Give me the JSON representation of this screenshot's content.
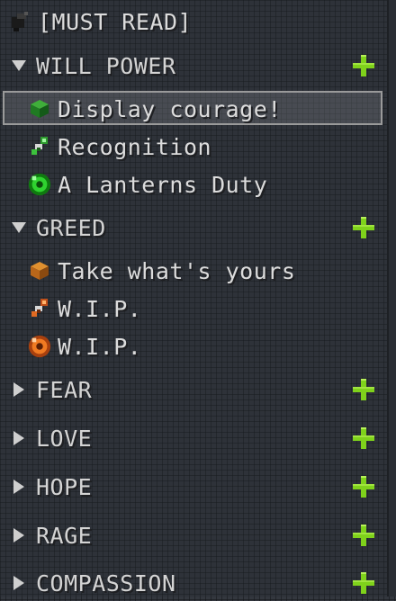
{
  "top_item": {
    "label": "[MUST READ]",
    "icon": "black-book-icon"
  },
  "categories": [
    {
      "label": "WILL POWER",
      "expanded": true,
      "add_icon": "plus-icon"
    },
    {
      "label": "GREED",
      "expanded": true,
      "add_icon": "plus-icon"
    },
    {
      "label": "FEAR",
      "expanded": false,
      "add_icon": "plus-icon"
    },
    {
      "label": "LOVE",
      "expanded": false,
      "add_icon": "plus-icon"
    },
    {
      "label": "HOPE",
      "expanded": false,
      "add_icon": "plus-icon"
    },
    {
      "label": "RAGE",
      "expanded": false,
      "add_icon": "plus-icon"
    },
    {
      "label": "COMPASSION",
      "expanded": false,
      "add_icon": "plus-icon"
    }
  ],
  "will_power_quests": [
    {
      "label": "Display courage!",
      "icon": "green-cube-icon",
      "selected": true
    },
    {
      "label": "Recognition",
      "icon": "green-ring-icon",
      "selected": false
    },
    {
      "label": "A Lanterns Duty",
      "icon": "green-lantern-icon",
      "selected": false
    }
  ],
  "greed_quests": [
    {
      "label": "Take what's yours",
      "icon": "orange-cube-icon",
      "selected": false
    },
    {
      "label": "W.I.P.",
      "icon": "orange-ring-icon",
      "selected": false
    },
    {
      "label": "W.I.P.",
      "icon": "orange-lantern-icon",
      "selected": false
    }
  ],
  "colors": {
    "plus": "#7fd21b",
    "selection_border": "#9a9a9a",
    "background": "#33373e"
  }
}
